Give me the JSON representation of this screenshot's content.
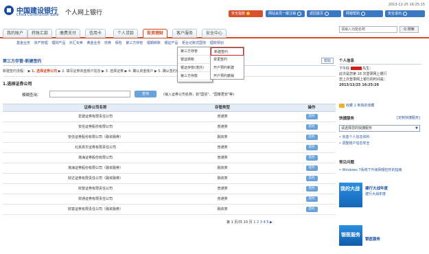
{
  "header": {
    "bank_cn": "中国建设银行",
    "bank_en": "China Construction Bank",
    "system_title": "个人网上银行",
    "datetime": "2013-12-25 16:25:15",
    "safe_btn": "安全指数",
    "site_btn": "网站会员一键注销",
    "home_btn": "返回首页",
    "help_btn": "网银帮助",
    "exit_btn": "安全退出"
  },
  "nav": {
    "tabs": [
      "我的账户",
      "转账汇款",
      "缴费支付",
      "信用卡",
      "个人贷款",
      "投资理财",
      "客户服务",
      "安全中心"
    ],
    "active_index": 5,
    "search_placeholder": "请输入功能名称",
    "search_btn": "Q 搜索"
  },
  "subnav": [
    "基金业务",
    "资产管理",
    "理财产品",
    "外汇买卖",
    "黄金业务",
    "债券",
    "保险",
    "第三方存管",
    "银期转账",
    "银证产品",
    "柜台记账式国债",
    "理财规划"
  ],
  "dropdown1": [
    "第三方存管",
    "银证转账",
    "银证存管(境外)",
    "第三方存款"
  ],
  "dropdown2": [
    "新建签约",
    "变更签约",
    "开户预约新建",
    "开户预约撤销"
  ],
  "content": {
    "section_title": "第三方存管-新建签约",
    "close": "帮助",
    "steps_prefix": "新建签约流程：",
    "step1": "1. 选择证券公司",
    "step_rest": "▶ 2. 填写证券资金账户信息 ▶ 3. 选择证券 ▶ 4. 确认资金账户 ▶ 5. 确认签约信息",
    "step_title": "1.选择证券公司",
    "query_label": "模糊查询：",
    "query_btn": "查询",
    "query_hint": "(输入证券公司名称，如\"国信\"、\"国泰君安\"等)"
  },
  "table": {
    "headers": [
      "证券公司名称",
      "存管类型",
      "操作"
    ],
    "rows": [
      {
        "name": "爱建证券有限责任公司",
        "type": "普通类",
        "op": "签约"
      },
      {
        "name": "安信证券股份有限公司",
        "type": "普通类",
        "op": "签约"
      },
      {
        "name": "安信证券股份有限公司（融资融券）",
        "type": "融资类",
        "op": "签约"
      },
      {
        "name": "北京高华证券有限责任公司",
        "type": "普通类",
        "op": "签约"
      },
      {
        "name": "渤海证券股份有限公司",
        "type": "普通类",
        "op": "签约"
      },
      {
        "name": "渤海证券股份有限公司（融资融券）",
        "type": "融资类",
        "op": "签约"
      },
      {
        "name": "财达证券有限责任公司（融资融券）",
        "type": "融资类",
        "op": "签约"
      },
      {
        "name": "财富证券有限责任公司",
        "type": "普通类",
        "op": "签约"
      },
      {
        "name": "财通证券有限责任公司",
        "type": "普通类",
        "op": "签约"
      },
      {
        "name": "财富证券有限责任公司（融资融券）",
        "type": "融资类",
        "op": "签约"
      }
    ],
    "pager": "第 1 页/共 10 页",
    "pages": "1 2 3 4 5 ▶"
  },
  "sidebar": {
    "info_title": "个人信息",
    "greeting": "下午好",
    "honorific": "先生：",
    "line2": "此次是您第 16 次登录网上银行",
    "line3": "您上次登录网上银行的时间是：",
    "last_login": "2013/12/25 16:25:26",
    "fav": "收藏 2 到我的收藏",
    "quick_title": "快捷服务",
    "quick_link": "[定制快捷服务]",
    "quick_select": "请选择您的快捷服务",
    "quick_items": [
      "• 完善个人信息资料",
      "• 调整账户信息安全"
    ],
    "faq_title": "常见问题",
    "faq_item": "• Windows 7系统下升级网银控件的指南",
    "ad1_block": "我的大战",
    "ad1_title": "建行大战年度",
    "ad1_sub": "建行大战年度",
    "ad2_block": "银医服务",
    "ad2_title": "银医服务"
  }
}
